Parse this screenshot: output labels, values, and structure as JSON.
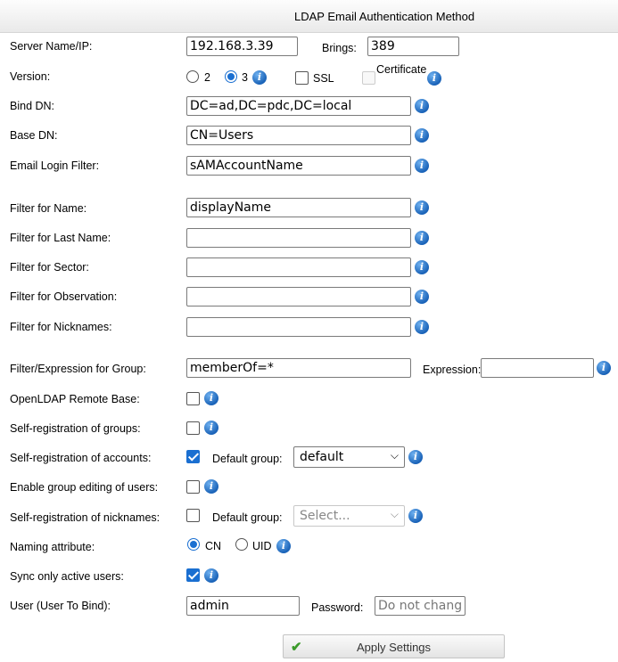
{
  "header": {
    "title": "LDAP Email Authentication Method"
  },
  "server": {
    "label": "Server Name/IP:",
    "value": "192.168.3.39",
    "port_label": "Brings:",
    "port_value": "389"
  },
  "version": {
    "label": "Version:",
    "option_2": "2",
    "option_3": "3",
    "ssl_label": "SSL",
    "certificate_label": "Certificate",
    "selected": "3"
  },
  "bind_dn": {
    "label": "Bind DN:",
    "value": "DC=ad,DC=pdc,DC=local"
  },
  "base_dn": {
    "label": "Base DN:",
    "value": "CN=Users"
  },
  "email_login_filter": {
    "label": "Email Login Filter:",
    "value": "sAMAccountName"
  },
  "filter_name": {
    "label": "Filter for Name:",
    "value": "displayName"
  },
  "filter_last_name": {
    "label": "Filter for Last Name:",
    "value": ""
  },
  "filter_sector": {
    "label": "Filter for Sector:",
    "value": ""
  },
  "filter_observation": {
    "label": "Filter for Observation:",
    "value": ""
  },
  "filter_nicknames": {
    "label": "Filter for Nicknames:",
    "value": ""
  },
  "filter_group": {
    "label": "Filter/Expression for Group:",
    "value": "memberOf=*",
    "expression_label": "Expression:",
    "expression_value": ""
  },
  "openldap_remote_base": {
    "label": "OpenLDAP Remote Base:",
    "checked": false
  },
  "self_registration_groups": {
    "label": "Self-registration of groups:",
    "checked": false
  },
  "self_registration_accounts": {
    "label": "Self-registration of accounts:",
    "checked": true,
    "default_group_label": "Default group:",
    "default_group_value": "default"
  },
  "enable_group_editing": {
    "label": "Enable group editing of users:",
    "checked": false
  },
  "self_registration_nicknames": {
    "label": "Self-registration of nicknames:",
    "checked": false,
    "default_group_label": "Default group:",
    "default_group_placeholder": "Select..."
  },
  "naming_attribute": {
    "label": "Naming attribute:",
    "option_cn": "CN",
    "option_uid": "UID",
    "selected": "CN"
  },
  "sync_active": {
    "label": "Sync only active users:",
    "checked": true
  },
  "bind_user": {
    "label": "User (User To Bind):",
    "value": "admin",
    "password_label": "Password:",
    "password_placeholder": "Do not change"
  },
  "apply_button": {
    "label": "Apply Settings"
  },
  "icons": {
    "info": "info-icon",
    "apply": "checkmark-icon"
  },
  "colors": {
    "accent": "#1a6fd1",
    "info_icon": "#1a63b8",
    "apply_check": "#3a9a2a"
  }
}
